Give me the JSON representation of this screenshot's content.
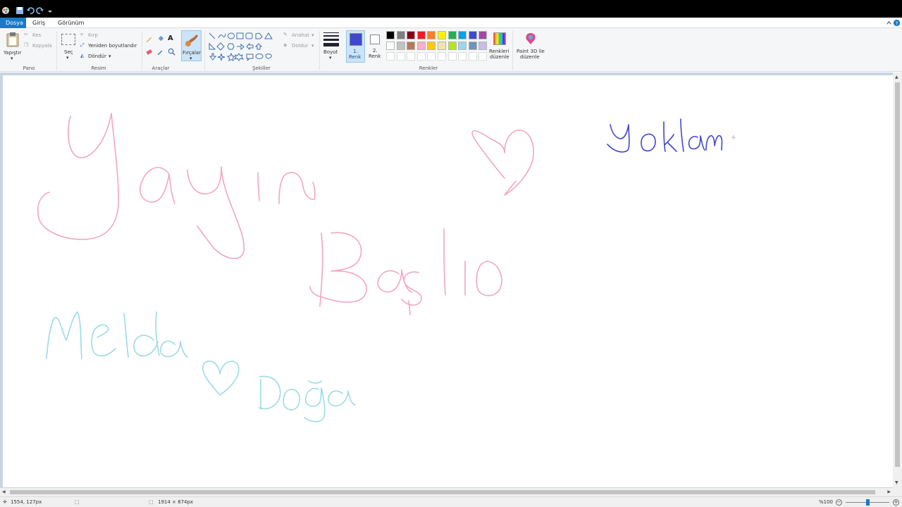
{
  "menu": {
    "tabs": [
      "Dosya",
      "Giriş",
      "Görünüm"
    ]
  },
  "ribbon": {
    "clipboard": {
      "paste": "Yapıştır",
      "cut": "Kes",
      "copy": "Kopyala",
      "group": "Pano"
    },
    "image": {
      "select": "Seç",
      "crop": "Kırp",
      "resize": "Yeniden boyutlandır",
      "rotate": "Döndür",
      "group": "Resim"
    },
    "tools": {
      "group": "Araçlar"
    },
    "brushes": {
      "label": "Fırçalar"
    },
    "shapes": {
      "outline": "Anahat",
      "fill": "Doldur",
      "group": "Şekiller"
    },
    "size": {
      "label": "Boyut"
    },
    "color1": {
      "line1": "1.",
      "line2": "Renk"
    },
    "color2": {
      "line1": "2.",
      "line2": "Renk"
    },
    "colors": {
      "group": "Renkler",
      "edit_line1": "Renkleri",
      "edit_line2": "düzenle"
    },
    "paint3d": {
      "line1": "Paint 3D ile",
      "line2": "düzenle"
    }
  },
  "palette": {
    "row1": [
      "#000000",
      "#7f7f7f",
      "#880015",
      "#ed1c24",
      "#ff7f27",
      "#fff200",
      "#22b14c",
      "#00a2e8",
      "#3f48cc",
      "#a349a4"
    ],
    "row2": [
      "#ffffff",
      "#c3c3c3",
      "#b97a57",
      "#ffaec9",
      "#ffc90e",
      "#efe4b0",
      "#b5e61d",
      "#99d9ea",
      "#7092be",
      "#c8bfe7"
    ]
  },
  "current_color": "#3f48cc",
  "drawing": {
    "pink": "#f2a7bf",
    "cyan": "#9bdbe4",
    "blue": "#3f48cc"
  },
  "status": {
    "cursor": "1554, 127px",
    "dimensions": "1914 × 874px",
    "zoom": "%100",
    "zoom_level": 0.5
  }
}
